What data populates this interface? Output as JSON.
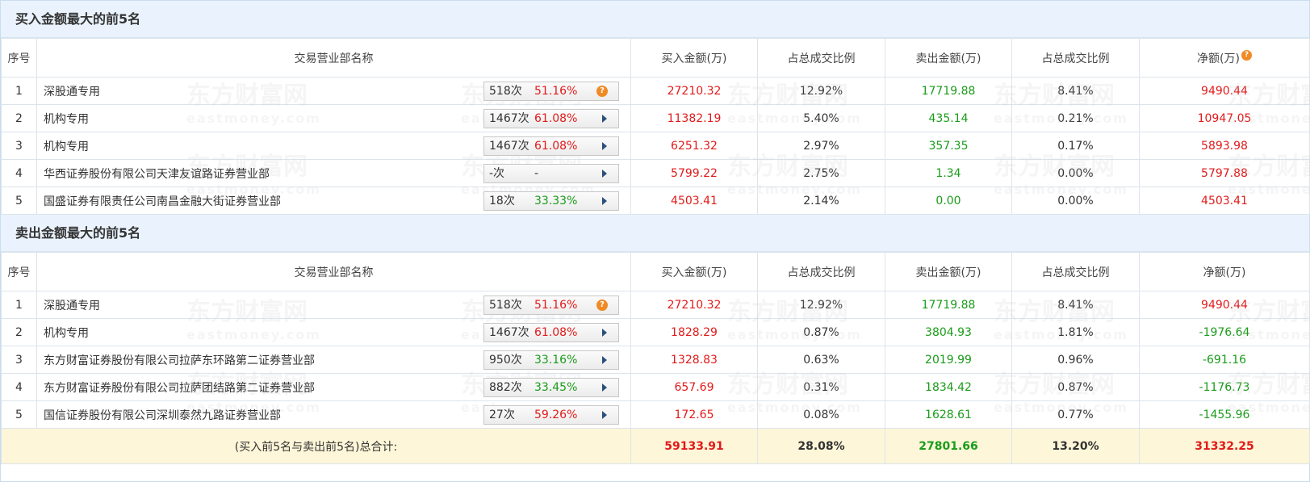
{
  "top_buy": {
    "title": "买入金额最大的前5名",
    "headers": [
      "序号",
      "交易营业部名称",
      "买入金额(万)",
      "占总成交比例",
      "卖出金额(万)",
      "占总成交比例",
      "净额(万)"
    ],
    "rows": [
      {
        "no": "1",
        "name": "深股通专用",
        "cnt": "518次",
        "pct": "51.16%",
        "pct_color": "red",
        "icon": "question-icon",
        "buy": "27210.32",
        "buy_ratio": "12.92%",
        "sell": "17719.88",
        "sell_ratio": "8.41%",
        "net": "9490.44",
        "net_color": "red"
      },
      {
        "no": "2",
        "name": "机构专用",
        "cnt": "1467次",
        "pct": "61.08%",
        "pct_color": "red",
        "icon": "arrow-right-icon",
        "buy": "11382.19",
        "buy_ratio": "5.40%",
        "sell": "435.14",
        "sell_ratio": "0.21%",
        "net": "10947.05",
        "net_color": "red"
      },
      {
        "no": "3",
        "name": "机构专用",
        "cnt": "1467次",
        "pct": "61.08%",
        "pct_color": "red",
        "icon": "arrow-right-icon",
        "buy": "6251.32",
        "buy_ratio": "2.97%",
        "sell": "357.35",
        "sell_ratio": "0.17%",
        "net": "5893.98",
        "net_color": "red"
      },
      {
        "no": "4",
        "name": "华西证券股份有限公司天津友谊路证券营业部",
        "cnt": "-次",
        "pct": "-",
        "pct_color": "dark",
        "icon": "arrow-right-icon",
        "buy": "5799.22",
        "buy_ratio": "2.75%",
        "sell": "1.34",
        "sell_ratio": "0.00%",
        "net": "5797.88",
        "net_color": "red"
      },
      {
        "no": "5",
        "name": "国盛证券有限责任公司南昌金融大街证券营业部",
        "cnt": "18次",
        "pct": "33.33%",
        "pct_color": "green",
        "icon": "arrow-right-icon",
        "buy": "4503.41",
        "buy_ratio": "2.14%",
        "sell": "0.00",
        "sell_ratio": "0.00%",
        "net": "4503.41",
        "net_color": "red"
      }
    ]
  },
  "top_sell": {
    "title": "卖出金额最大的前5名",
    "headers": [
      "序号",
      "交易营业部名称",
      "买入金额(万)",
      "占总成交比例",
      "卖出金额(万)",
      "占总成交比例",
      "净额(万)"
    ],
    "rows": [
      {
        "no": "1",
        "name": "深股通专用",
        "cnt": "518次",
        "pct": "51.16%",
        "pct_color": "red",
        "icon": "question-icon",
        "buy": "27210.32",
        "buy_ratio": "12.92%",
        "sell": "17719.88",
        "sell_ratio": "8.41%",
        "net": "9490.44",
        "net_color": "red"
      },
      {
        "no": "2",
        "name": "机构专用",
        "cnt": "1467次",
        "pct": "61.08%",
        "pct_color": "red",
        "icon": "arrow-right-icon",
        "buy": "1828.29",
        "buy_ratio": "0.87%",
        "sell": "3804.93",
        "sell_ratio": "1.81%",
        "net": "-1976.64",
        "net_color": "green"
      },
      {
        "no": "3",
        "name": "东方财富证券股份有限公司拉萨东环路第二证券营业部",
        "cnt": "950次",
        "pct": "33.16%",
        "pct_color": "green",
        "icon": "arrow-right-icon",
        "buy": "1328.83",
        "buy_ratio": "0.63%",
        "sell": "2019.99",
        "sell_ratio": "0.96%",
        "net": "-691.16",
        "net_color": "green"
      },
      {
        "no": "4",
        "name": "东方财富证券股份有限公司拉萨团结路第二证券营业部",
        "cnt": "882次",
        "pct": "33.45%",
        "pct_color": "green",
        "icon": "arrow-right-icon",
        "buy": "657.69",
        "buy_ratio": "0.31%",
        "sell": "1834.42",
        "sell_ratio": "0.87%",
        "net": "-1176.73",
        "net_color": "green"
      },
      {
        "no": "5",
        "name": "国信证券股份有限公司深圳泰然九路证券营业部",
        "cnt": "27次",
        "pct": "59.26%",
        "pct_color": "red",
        "icon": "arrow-right-icon",
        "buy": "172.65",
        "buy_ratio": "0.08%",
        "sell": "1628.61",
        "sell_ratio": "0.77%",
        "net": "-1455.96",
        "net_color": "green"
      }
    ]
  },
  "total": {
    "label": "(买入前5名与卖出前5名)总合计:",
    "buy": "59133.91",
    "buy_ratio": "28.08%",
    "sell": "27801.66",
    "sell_ratio": "13.20%",
    "net": "31332.25"
  },
  "watermark": {
    "brand": "东方财富网",
    "domain": "eastmoney.com"
  },
  "icons": {
    "question": "?"
  },
  "colors": {
    "red": "#e21a1a",
    "green": "#1a9c1a",
    "header_bg": "#eaf3fd",
    "total_bg": "#fdf6d8"
  }
}
